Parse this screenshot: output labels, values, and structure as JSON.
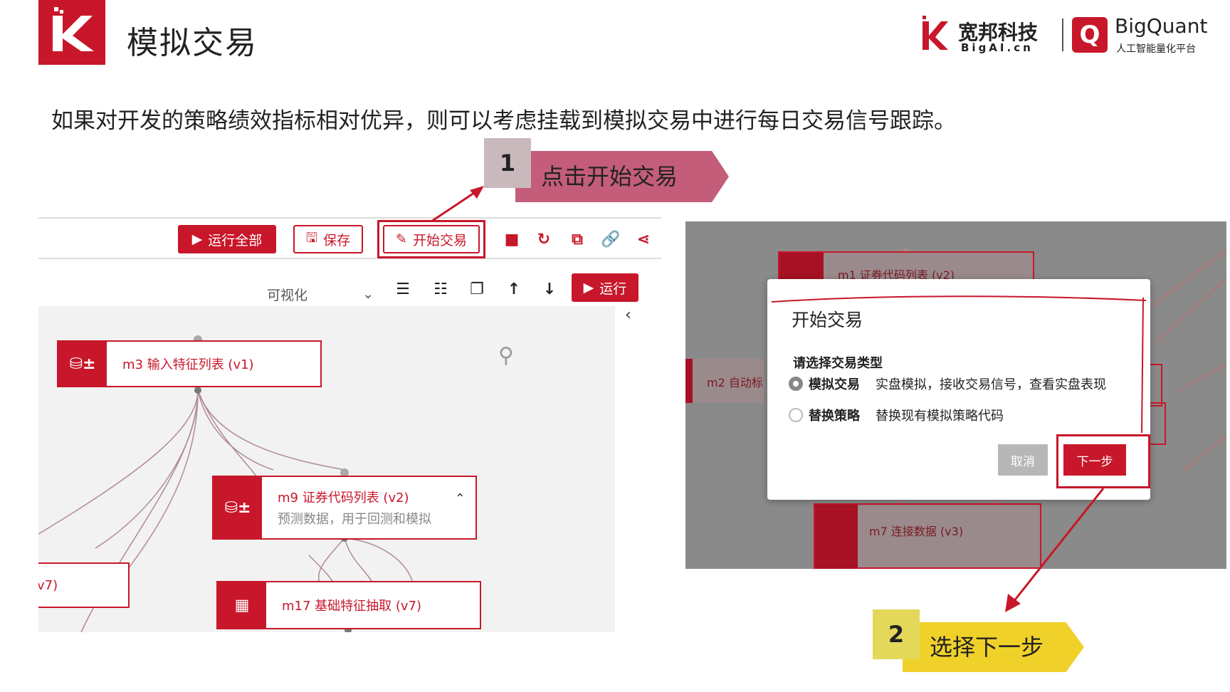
{
  "header": {
    "title": "模拟交易",
    "brand_name": "宽邦科技",
    "brand_sub": "BigAI.cn",
    "bq_name": "BigQuant",
    "bq_sub": "人工智能量化平台"
  },
  "intro": "如果对开发的策略绩效指标相对优异，则可以考虑挂载到模拟交易中进行每日交易信号跟踪。",
  "step1": {
    "num": "1",
    "label": "点击开始交易"
  },
  "step2": {
    "num": "2",
    "label": "选择下一步"
  },
  "toolbar": {
    "run_all": "运行全部",
    "save": "保存",
    "start_trade": "开始交易",
    "view_select": "可视化",
    "run": "运行"
  },
  "nodes": {
    "m3": {
      "title": "m3 输入特征列表 (v1)"
    },
    "m9": {
      "title": "m9 证券代码列表 (v2)",
      "sub": "预测数据，用于回测和模拟"
    },
    "m17": {
      "title": "m17 基础特征抽取 (v7)"
    },
    "partial": {
      "title": "v7)"
    }
  },
  "bg_nodes": {
    "m1": "m1 证券代码列表 (v2)",
    "m2": "m2 自动标",
    "m7": "m7 连接数据 (v3)"
  },
  "dialog": {
    "title": "开始交易",
    "label": "请选择交易类型",
    "options": [
      {
        "name": "模拟交易",
        "desc": "实盘模拟，接收交易信号，查看实盘表现",
        "selected": true
      },
      {
        "name": "替换策略",
        "desc": "替换现有模拟策略代码",
        "selected": false
      }
    ],
    "cancel": "取消",
    "next": "下一步"
  },
  "colors": {
    "accent": "#c8172a",
    "step1": "#c35d7a",
    "step2": "#f0d12a"
  }
}
